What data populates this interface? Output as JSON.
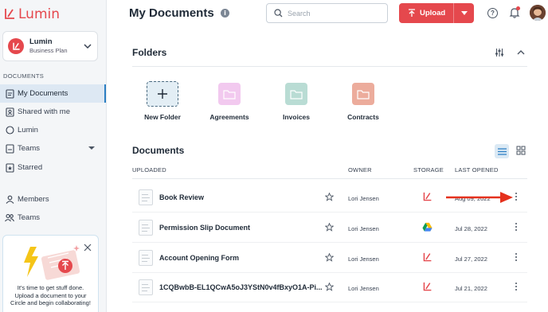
{
  "brand": {
    "name": "Lumin",
    "accent": "#e5484d",
    "link": "#2b7fc3"
  },
  "workspace": {
    "name": "Lumin",
    "plan": "Business Plan",
    "icon": "chevron-down-icon"
  },
  "sidebar": {
    "section_label": "DOCUMENTS",
    "items": [
      {
        "label": "My Documents",
        "icon": "document-icon",
        "active": true
      },
      {
        "label": "Shared with me",
        "icon": "shared-icon"
      },
      {
        "label": "Lumin",
        "icon": "circle-icon"
      },
      {
        "label": "Teams",
        "icon": "teams-folder-icon",
        "has_caret": true
      },
      {
        "label": "Starred",
        "icon": "star-folder-icon"
      }
    ],
    "people": [
      {
        "label": "Members",
        "icon": "member-icon"
      },
      {
        "label": "Teams",
        "icon": "teams-icon"
      }
    ],
    "promo": {
      "text": "It's time to get stuff done. Upload a document to your Circle and begin collaborating!"
    }
  },
  "header": {
    "title": "My Documents",
    "info": "i",
    "search": {
      "placeholder": "Search",
      "value": ""
    },
    "upload_label": "Upload",
    "help": "?"
  },
  "folders": {
    "title": "Folders",
    "items": [
      {
        "label": "New Folder",
        "color": "#e3eef5"
      },
      {
        "label": "Agreements",
        "color": "#f2c9ef"
      },
      {
        "label": "Invoices",
        "color": "#b9dcd4"
      },
      {
        "label": "Contracts",
        "color": "#ecac9c"
      }
    ]
  },
  "documents": {
    "title": "Documents",
    "columns": {
      "uploaded": "UPLOADED",
      "owner": "OWNER",
      "storage": "STORAGE",
      "last_opened": "LAST OPENED"
    },
    "rows": [
      {
        "name": "Book Review",
        "owner": "Lori Jensen",
        "storage": "lumin",
        "date": "Aug 09, 2022"
      },
      {
        "name": "Permission Slip Document",
        "owner": "Lori Jensen",
        "storage": "google-drive",
        "date": "Jul 28, 2022"
      },
      {
        "name": "Account Opening Form",
        "owner": "Lori Jensen",
        "storage": "lumin",
        "date": "Jul 27, 2022"
      },
      {
        "name": "1CQBwbB-EL1QCwA5oJ3YStN0v4fBxyO1A-Pi...",
        "owner": "Lori Jensen",
        "storage": "lumin",
        "date": "Jul 21, 2022"
      }
    ]
  }
}
